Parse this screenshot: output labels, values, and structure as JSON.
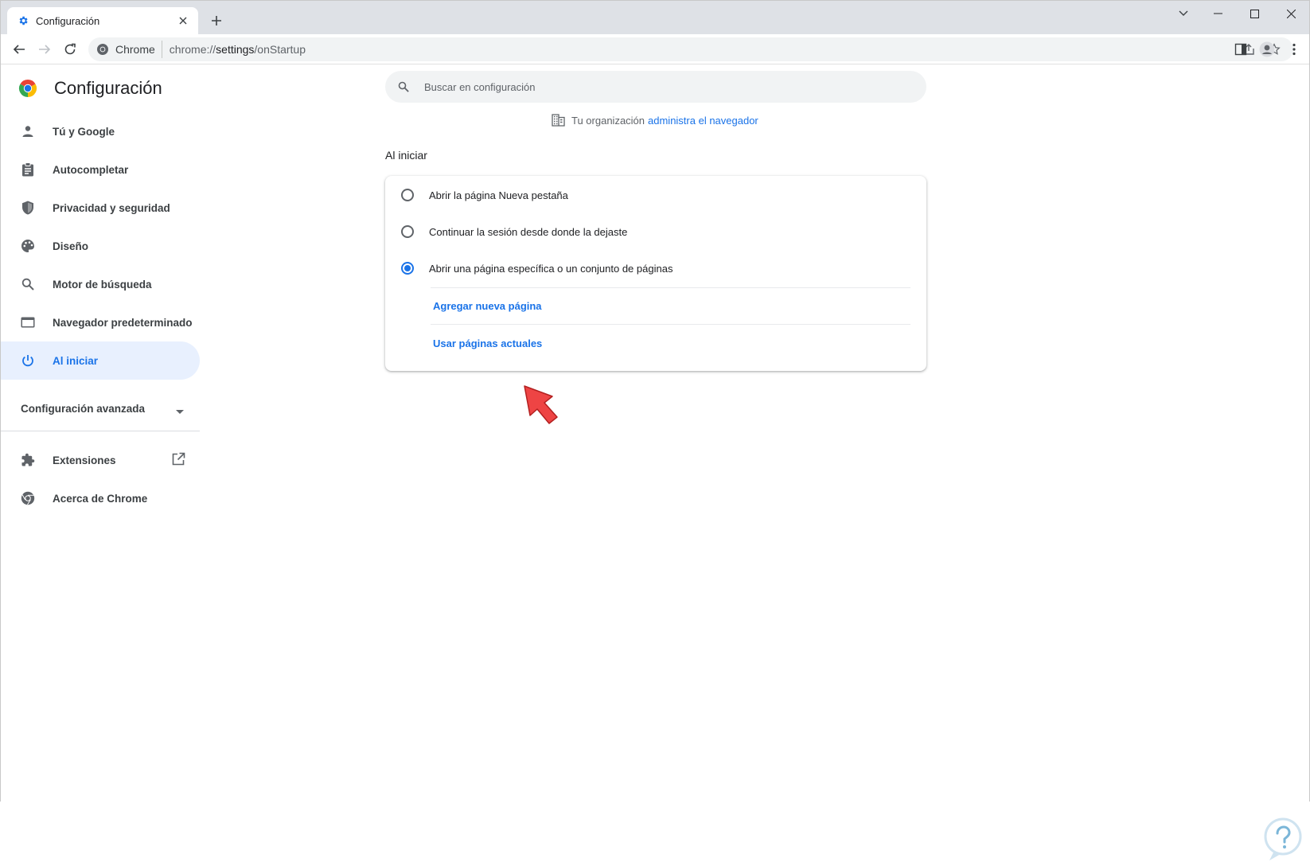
{
  "tab": {
    "title": "Configuración"
  },
  "omnibox": {
    "site": "Chrome",
    "url_prefix": "chrome://",
    "url_host": "settings",
    "url_path": "/onStartup"
  },
  "page": {
    "title": "Configuración"
  },
  "nav": {
    "items": [
      {
        "label": "Tú y Google",
        "icon": "person-icon"
      },
      {
        "label": "Autocompletar",
        "icon": "clipboard-icon"
      },
      {
        "label": "Privacidad y seguridad",
        "icon": "shield-icon"
      },
      {
        "label": "Diseño",
        "icon": "palette-icon"
      },
      {
        "label": "Motor de búsqueda",
        "icon": "search-icon"
      },
      {
        "label": "Navegador predeterminado",
        "icon": "browser-icon"
      },
      {
        "label": "Al iniciar",
        "icon": "power-icon",
        "active": true
      }
    ],
    "advanced": "Configuración avanzada",
    "extensions": "Extensiones",
    "about": "Acerca de Chrome"
  },
  "search": {
    "placeholder": "Buscar en configuración"
  },
  "managed": {
    "text": "Tu organización",
    "link": "administra el navegador"
  },
  "startup": {
    "title": "Al iniciar",
    "options": [
      {
        "label": "Abrir la página Nueva pestaña",
        "checked": false
      },
      {
        "label": "Continuar la sesión desde donde la dejaste",
        "checked": false
      },
      {
        "label": "Abrir una página específica o un conjunto de páginas",
        "checked": true
      }
    ],
    "add_page": "Agregar nueva página",
    "use_current": "Usar páginas actuales"
  },
  "colors": {
    "accent": "#1a73e8",
    "active_bg": "#e8f0fe",
    "pointer": "#ee4444"
  }
}
